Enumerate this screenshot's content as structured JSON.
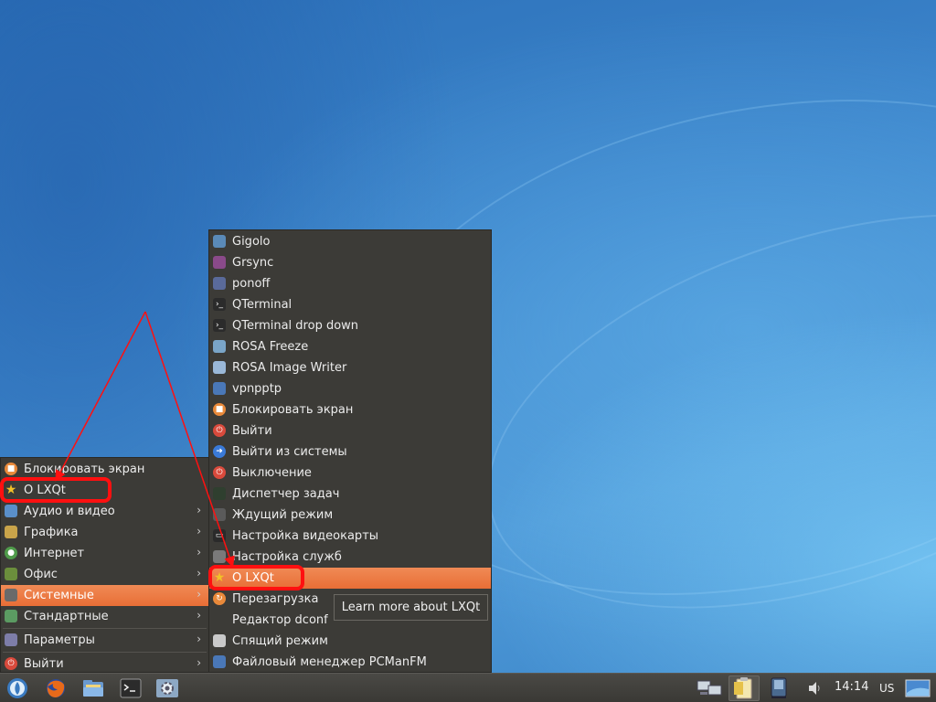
{
  "main_menu": {
    "items": [
      {
        "label": "Блокировать экран",
        "icon": "lock-icon",
        "color": "#e9893a",
        "submenu": false
      },
      {
        "label": "О LXQt",
        "icon": "star-icon",
        "color": "#f2c128",
        "submenu": false
      },
      {
        "label": "Аудио и видео",
        "icon": "multimedia-icon",
        "color": "#5a8fc9",
        "submenu": true
      },
      {
        "label": "Графика",
        "icon": "graphics-icon",
        "color": "#c9a44a",
        "submenu": true
      },
      {
        "label": "Интернет",
        "icon": "globe-icon",
        "color": "#4f9b4a",
        "submenu": true
      },
      {
        "label": "Офис",
        "icon": "office-icon",
        "color": "#6b8e3c",
        "submenu": true
      },
      {
        "label": "Системные",
        "icon": "system-icon",
        "color": "#6a6a6a",
        "submenu": true,
        "active": true
      },
      {
        "label": "Стандартные",
        "icon": "accessories-icon",
        "color": "#5b9b62",
        "submenu": true
      },
      {
        "label": "Параметры",
        "icon": "settings-icon",
        "color": "#7d7da8",
        "submenu": true
      },
      {
        "label": "Выйти",
        "icon": "power-icon",
        "color": "#d94a3c",
        "submenu": true
      }
    ]
  },
  "sub_menu": {
    "items": [
      {
        "label": "Gigolo",
        "icon": "gigolo-icon",
        "color": "#5a8ab8"
      },
      {
        "label": "Grsync",
        "icon": "grsync-icon",
        "color": "#8a4a8a"
      },
      {
        "label": "ponoff",
        "icon": "ponoff-icon",
        "color": "#5a6a9a"
      },
      {
        "label": "QTerminal",
        "icon": "terminal-icon",
        "color": "#2b2b2b"
      },
      {
        "label": "QTerminal drop down",
        "icon": "terminal-icon",
        "color": "#2b2b2b"
      },
      {
        "label": "ROSA Freeze",
        "icon": "freeze-icon",
        "color": "#7aa5c8"
      },
      {
        "label": "ROSA Image Writer",
        "icon": "usb-icon",
        "color": "#9ab8d8"
      },
      {
        "label": "vpnpptp",
        "icon": "vpn-icon",
        "color": "#4a78b8"
      },
      {
        "label": "Блокировать экран",
        "icon": "lock-icon",
        "color": "#e9893a"
      },
      {
        "label": "Выйти",
        "icon": "power-icon",
        "color": "#d94a3c"
      },
      {
        "label": "Выйти из системы",
        "icon": "logout-icon",
        "color": "#3a7ad8"
      },
      {
        "label": "Выключение",
        "icon": "shutdown-icon",
        "color": "#d94a3c"
      },
      {
        "label": "Диспетчер задач",
        "icon": "task-manager-icon",
        "color": "#2f3f2f"
      },
      {
        "label": "Ждущий режим",
        "icon": "standby-icon",
        "color": "#5a5a5a"
      },
      {
        "label": "Настройка видеокарты",
        "icon": "monitor-icon",
        "color": "#2a2a2a"
      },
      {
        "label": "Настройка служб",
        "icon": "services-icon",
        "color": "#7a7a7a"
      },
      {
        "label": "О LXQt",
        "icon": "star-icon",
        "color": "#f2c128",
        "active": true
      },
      {
        "label": "Перезагрузка",
        "icon": "reboot-icon",
        "color": "#e9893a"
      },
      {
        "label": "Редактор dconf",
        "icon": "",
        "color": ""
      },
      {
        "label": "Спящий режим",
        "icon": "sleep-icon",
        "color": "#c9c9c9"
      },
      {
        "label": "Файловый менеджер PCManFM",
        "icon": "file-manager-icon",
        "color": "#4a78b8"
      }
    ]
  },
  "tooltip": "Learn more about LXQt",
  "taskbar": {
    "launchers": [
      {
        "name": "start-menu-button",
        "icon": "rosa-logo-icon"
      },
      {
        "name": "firefox-launcher",
        "icon": "firefox-icon"
      },
      {
        "name": "file-manager-launcher",
        "icon": "folder-icon"
      },
      {
        "name": "terminal-launcher",
        "icon": "terminal-icon"
      },
      {
        "name": "settings-launcher",
        "icon": "settings-icon"
      }
    ],
    "clock": "14:14",
    "keyboard_layout": "US"
  },
  "colors": {
    "menu_bg": "#3c3b37",
    "highlight": "#e8733b",
    "annotation": "#ff1010"
  }
}
